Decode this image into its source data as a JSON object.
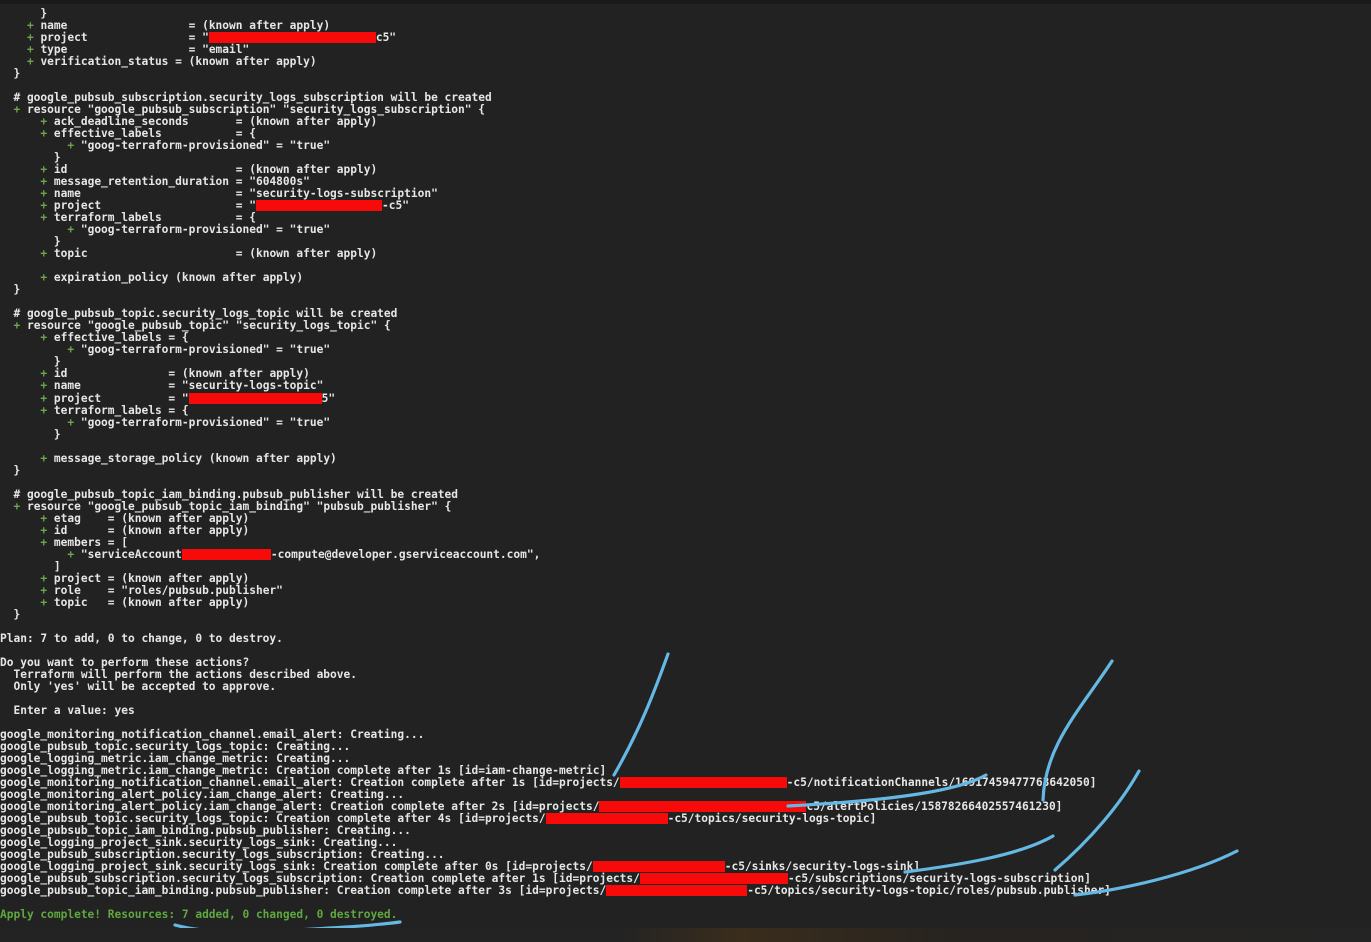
{
  "terminal": {
    "background_color": "#222222",
    "text_color": "#d9d9d9",
    "green_color": "#6aa84f",
    "redaction_color": "#f60a0a",
    "annotation_color": "#64b9e4"
  },
  "lines": [
    {
      "id": "l001",
      "text": "      }"
    },
    {
      "id": "l002",
      "text": "    + name                  = (known after apply)",
      "plus": true
    },
    {
      "id": "l003",
      "text": "    + project               = \"",
      "plus": true,
      "redact": 167,
      "suffix": "c5\""
    },
    {
      "id": "l004",
      "text": "    + type                  = \"email\"",
      "plus": true
    },
    {
      "id": "l005",
      "text": "    + verification_status = (known after apply)",
      "plus": true
    },
    {
      "id": "l006",
      "text": "  }"
    },
    {
      "id": "l007",
      "text": ""
    },
    {
      "id": "l008",
      "text": "  # google_pubsub_subscription.security_logs_subscription will be created",
      "bold": true
    },
    {
      "id": "l009",
      "text": "  + resource \"google_pubsub_subscription\" \"security_logs_subscription\" {",
      "plus": true
    },
    {
      "id": "l010",
      "text": "      + ack_deadline_seconds       = (known after apply)",
      "plus": true
    },
    {
      "id": "l011",
      "text": "      + effective_labels           = {",
      "plus": true
    },
    {
      "id": "l012",
      "text": "          + \"goog-terraform-provisioned\" = \"true\"",
      "plus": true
    },
    {
      "id": "l013",
      "text": "        }"
    },
    {
      "id": "l014",
      "text": "      + id                         = (known after apply)",
      "plus": true
    },
    {
      "id": "l015",
      "text": "      + message_retention_duration = \"604800s\"",
      "plus": true
    },
    {
      "id": "l016",
      "text": "      + name                       = \"security-logs-subscription\"",
      "plus": true
    },
    {
      "id": "l017",
      "text": "      + project                    = \"",
      "plus": true,
      "redact": 126,
      "suffix": "-c5\""
    },
    {
      "id": "l018",
      "text": "      + terraform_labels           = {",
      "plus": true
    },
    {
      "id": "l019",
      "text": "          + \"goog-terraform-provisioned\" = \"true\"",
      "plus": true
    },
    {
      "id": "l020",
      "text": "        }"
    },
    {
      "id": "l021",
      "text": "      + topic                      = (known after apply)",
      "plus": true
    },
    {
      "id": "l022",
      "text": ""
    },
    {
      "id": "l023",
      "text": "      + expiration_policy (known after apply)",
      "plus": true
    },
    {
      "id": "l024",
      "text": "  }"
    },
    {
      "id": "l025",
      "text": ""
    },
    {
      "id": "l026",
      "text": "  # google_pubsub_topic.security_logs_topic will be created",
      "bold": true
    },
    {
      "id": "l027",
      "text": "  + resource \"google_pubsub_topic\" \"security_logs_topic\" {",
      "plus": true
    },
    {
      "id": "l028",
      "text": "      + effective_labels = {",
      "plus": true
    },
    {
      "id": "l029",
      "text": "          + \"goog-terraform-provisioned\" = \"true\"",
      "plus": true
    },
    {
      "id": "l030",
      "text": "        }"
    },
    {
      "id": "l031",
      "text": "      + id               = (known after apply)",
      "plus": true
    },
    {
      "id": "l032",
      "text": "      + name             = \"security-logs-topic\"",
      "plus": true
    },
    {
      "id": "l033",
      "text": "      + project          = \"",
      "plus": true,
      "redact": 133,
      "suffix": "5\""
    },
    {
      "id": "l034",
      "text": "      + terraform_labels = {",
      "plus": true
    },
    {
      "id": "l035",
      "text": "          + \"goog-terraform-provisioned\" = \"true\"",
      "plus": true
    },
    {
      "id": "l036",
      "text": "        }"
    },
    {
      "id": "l037",
      "text": ""
    },
    {
      "id": "l038",
      "text": "      + message_storage_policy (known after apply)",
      "plus": true
    },
    {
      "id": "l039",
      "text": "  }"
    },
    {
      "id": "l040",
      "text": ""
    },
    {
      "id": "l041",
      "text": "  # google_pubsub_topic_iam_binding.pubsub_publisher will be created",
      "bold": true
    },
    {
      "id": "l042",
      "text": "  + resource \"google_pubsub_topic_iam_binding\" \"pubsub_publisher\" {",
      "plus": true
    },
    {
      "id": "l043",
      "text": "      + etag    = (known after apply)",
      "plus": true
    },
    {
      "id": "l044",
      "text": "      + id      = (known after apply)",
      "plus": true
    },
    {
      "id": "l045",
      "text": "      + members = [",
      "plus": true
    },
    {
      "id": "l046",
      "text": "          + \"serviceAccount",
      "plus": true,
      "redact": 89,
      "suffix": "-compute@developer.gserviceaccount.com\","
    },
    {
      "id": "l047",
      "text": "        ]"
    },
    {
      "id": "l048",
      "text": "      + project = (known after apply)",
      "plus": true
    },
    {
      "id": "l049",
      "text": "      + role    = \"roles/pubsub.publisher\"",
      "plus": true
    },
    {
      "id": "l050",
      "text": "      + topic   = (known after apply)",
      "plus": true
    },
    {
      "id": "l051",
      "text": "  }"
    },
    {
      "id": "l052",
      "text": ""
    },
    {
      "id": "l053",
      "text": "Plan: 7 to add, 0 to change, 0 to destroy.",
      "bold": true
    },
    {
      "id": "l054",
      "text": ""
    },
    {
      "id": "l055",
      "text": "Do you want to perform these actions?",
      "bold": true
    },
    {
      "id": "l056",
      "text": "  Terraform will perform the actions described above."
    },
    {
      "id": "l057",
      "text": "  Only 'yes' will be accepted to approve."
    },
    {
      "id": "l058",
      "text": ""
    },
    {
      "id": "l059",
      "text": "  Enter a value: yes"
    },
    {
      "id": "l060",
      "text": ""
    },
    {
      "id": "l061",
      "text": "google_monitoring_notification_channel.email_alert: Creating..."
    },
    {
      "id": "l062",
      "text": "google_pubsub_topic.security_logs_topic: Creating..."
    },
    {
      "id": "l063",
      "text": "google_logging_metric.iam_change_metric: Creating..."
    },
    {
      "id": "l064",
      "text": "google_logging_metric.iam_change_metric: Creation complete after 1s [id=iam-change-metric]"
    },
    {
      "id": "l065",
      "text": "google_monitoring_notification_channel.email_alert: Creation complete after 1s [id=projects/",
      "redact": 167,
      "suffix": "-c5/notificationChannels/16917459477763642050]"
    },
    {
      "id": "l066",
      "text": "google_monitoring_alert_policy.iam_change_alert: Creating..."
    },
    {
      "id": "l067",
      "text": "google_monitoring_alert_policy.iam_change_alert: Creation complete after 2s [id=projects/",
      "redact": 207,
      "suffix": "c5/alertPolicies/15878266402557461230]"
    },
    {
      "id": "l068",
      "text": "google_pubsub_topic.security_logs_topic: Creation complete after 4s [id=projects/",
      "redact": 122,
      "suffix": "-c5/topics/security-logs-topic]"
    },
    {
      "id": "l069",
      "text": "google_pubsub_topic_iam_binding.pubsub_publisher: Creating..."
    },
    {
      "id": "l070",
      "text": "google_logging_project_sink.security_logs_sink: Creating..."
    },
    {
      "id": "l071",
      "text": "google_pubsub_subscription.security_logs_subscription: Creating..."
    },
    {
      "id": "l072",
      "text": "google_logging_project_sink.security_logs_sink: Creation complete after 0s [id=projects/",
      "redact": 132,
      "suffix": "-c5/sinks/security-logs-sink]"
    },
    {
      "id": "l073",
      "text": "google_pubsub_subscription.security_logs_subscription: Creation complete after 1s [id=projects/",
      "redact": 148,
      "suffix": "-c5/subscriptions/security-logs-subscription]"
    },
    {
      "id": "l074",
      "text": "google_pubsub_topic_iam_binding.pubsub_publisher: Creation complete after 3s [id=projects/",
      "redact": 141,
      "suffix": "-c5/topics/security-logs-topic/roles/pubsub.publisher]"
    },
    {
      "id": "l075",
      "text": ""
    },
    {
      "id": "l076",
      "text": "Apply complete! Resources: 7 added, 0 changed, 0 destroyed.",
      "green": true
    }
  ],
  "annotations": {
    "type": "hand-drawn-curves",
    "color": "#64b9e4",
    "count": 7,
    "paths": [
      "M 668 654 C 655 690, 640 730, 614 775",
      "M 1112 661 C 1080 710, 1045 745, 1043 800",
      "M 986 775 C 960 790, 900 800, 788 806",
      "M 1139 771 C 1120 805, 1090 840, 1055 870",
      "M 1053 836 C 1020 855, 960 865, 905 872",
      "M 1237 851 C 1190 875, 1120 890, 1075 895",
      "M 175 925 C 210 935, 270 932, 330 928 C 365 926, 385 924, 400 922"
    ]
  },
  "summary": {
    "plan_add": 7,
    "plan_change": 0,
    "plan_destroy": 0,
    "applied_add": 7,
    "applied_change": 0,
    "applied_destroy": 0,
    "prompt_answer": "yes"
  }
}
